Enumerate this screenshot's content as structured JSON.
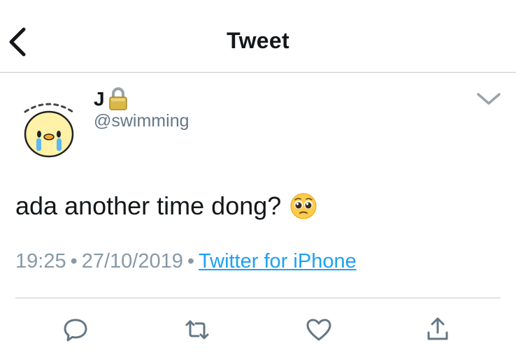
{
  "header": {
    "title": "Tweet"
  },
  "tweet": {
    "display_name": "J",
    "handle": "@swimming",
    "text": "ada another time dong?",
    "time": "19:25",
    "separator": "•",
    "date": "27/10/2019",
    "source": "Twitter for iPhone"
  },
  "icons": {
    "back": "chevron-left-icon",
    "lock": "lock-icon",
    "more": "chevron-down-icon",
    "emoji": "pleading-face-emoji",
    "reply": "reply-icon",
    "retweet": "retweet-icon",
    "like": "heart-icon",
    "share": "share-icon"
  },
  "colors": {
    "link": "#1da1f2",
    "secondary_text": "#8899a6",
    "handle_text": "#657786",
    "icon": "#657786"
  }
}
